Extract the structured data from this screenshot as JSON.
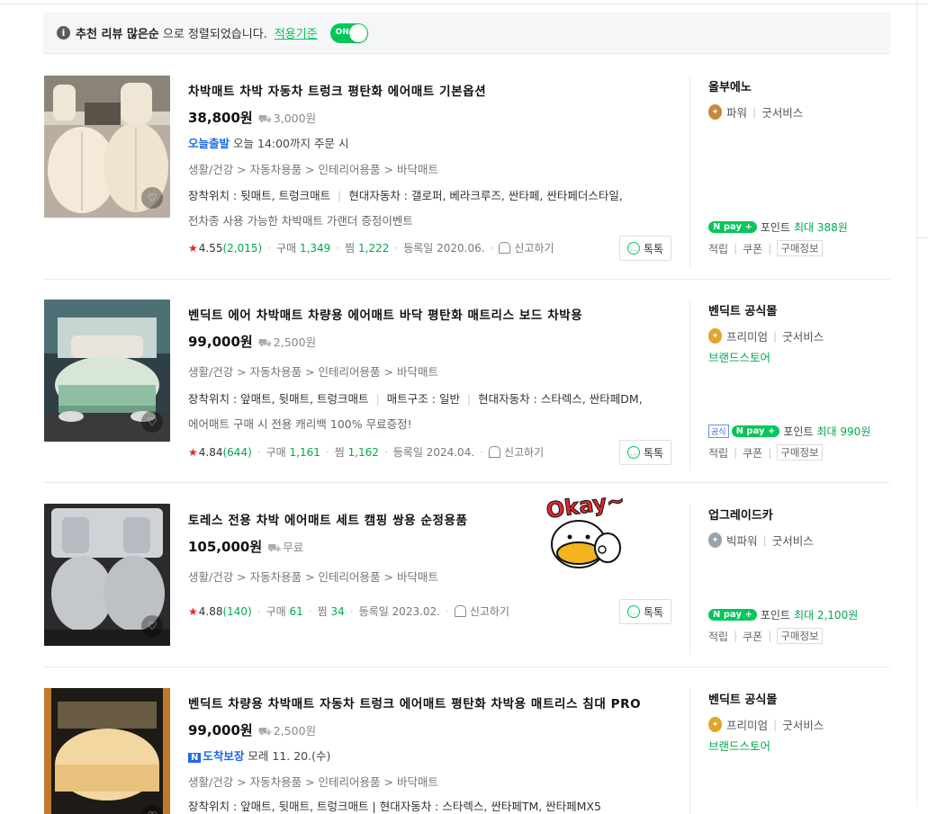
{
  "notice": {
    "sort_bold": "추천 리뷰 많은순",
    "sort_rest": " 으로 정렬되었습니다.",
    "link": "적용기준",
    "toggle": "ON"
  },
  "items": [
    {
      "title": "차박매트 차박 자동차 트렁크 평탄화 에어매트 기본옵션",
      "price": "38,800원",
      "shipping": "3,000원",
      "delivery_tag": "오늘출발",
      "delivery_text": "오늘 14:00까지 주문 시",
      "category": "생활/건강 > 자동차용품 > 인테리어용품 > 바닥매트",
      "spec_a": "장착위치 : 뒷매트, 트렁크매트",
      "spec_b": "현대자동차 : 갤로퍼, 베라크루즈, 싼타페, 싼타페더스타일,",
      "desc": "전차종 사용 가능한 차박매트 가랜더 증정이벤트",
      "rating": "4.55",
      "reviews": "(2,015)",
      "buy_label": "구매",
      "buy": "1,349",
      "zzim_label": "찜",
      "zzim": "1,222",
      "date": "등록일 2020.06.",
      "report": "신고하기",
      "talk": "톡톡",
      "seller": "올부에노",
      "grade": "파워",
      "service": "굿서비스",
      "points_label": "포인트",
      "points_value": "최대 388원",
      "link1": "적립",
      "link2": "쿠폰",
      "link3": "구매정보"
    },
    {
      "title": "벤딕트 에어 차박매트 차량용 에어매트 바닥 평탄화 매트리스 보드 차박용",
      "price": "99,000원",
      "shipping": "2,500원",
      "category": "생활/건강 > 자동차용품 > 인테리어용품 > 바닥매트",
      "spec_a": "장착위치 : 앞매트, 뒷매트, 트렁크매트",
      "spec_b": "매트구조 : 일반",
      "spec_c": "현대자동차 : 스타렉스, 싼타페DM,",
      "desc": "에어매트 구매 시 전용 캐리백 100% 무료증정!",
      "rating": "4.84",
      "reviews": "(644)",
      "buy_label": "구매",
      "buy": "1,161",
      "zzim_label": "찜",
      "zzim": "1,162",
      "date": "등록일 2024.04.",
      "report": "신고하기",
      "talk": "톡톡",
      "seller": "벤딕트 공식몰",
      "grade": "프리미엄",
      "service": "굿서비스",
      "brandstore": "브랜드스토어",
      "official": "공식",
      "points_label": "포인트",
      "points_value": "최대 990원",
      "link1": "적립",
      "link2": "쿠폰",
      "link3": "구매정보"
    },
    {
      "title": "토레스 전용 차박 에어매트 세트 캠핑 쌍용 순정용품",
      "price": "105,000원",
      "shipping": "무료",
      "category": "생활/건강 > 자동차용품 > 인테리어용품 > 바닥매트",
      "rating": "4.88",
      "reviews": "(140)",
      "buy_label": "구매",
      "buy": "61",
      "zzim_label": "찜",
      "zzim": "34",
      "date": "등록일 2023.02.",
      "report": "신고하기",
      "talk": "톡톡",
      "seller": "업그레이드카",
      "grade": "빅파워",
      "service": "굿서비스",
      "points_label": "포인트",
      "points_value": "최대 2,100원",
      "link1": "적립",
      "link2": "쿠폰",
      "link3": "구매정보",
      "sticker": "Okay~"
    },
    {
      "title": "벤딕트 차량용 차박매트 자동차 트렁크 에어매트 평탄화 차박용 매트리스 침대 PRO",
      "price": "99,000원",
      "shipping": "2,500원",
      "delivery_tag": "도착보장",
      "delivery_text": "모레 11. 20.(수)",
      "category": "생활/건강 > 자동차용품 > 인테리어용품 > 바닥매트",
      "spec_partial": "장착위치 : 앞매트, 뒷매트, 트렁크매트 | 현대자동차 : 스타렉스, 싼타페TM, 싼타페MX5",
      "seller": "벤딕트 공식몰",
      "grade": "프리미엄",
      "service": "굿서비스",
      "brandstore": "브랜드스토어"
    }
  ],
  "colors": {
    "accent": "#03c75a",
    "blue": "#1e6be6",
    "star": "#e8261f"
  },
  "npay_label": "N pay +"
}
